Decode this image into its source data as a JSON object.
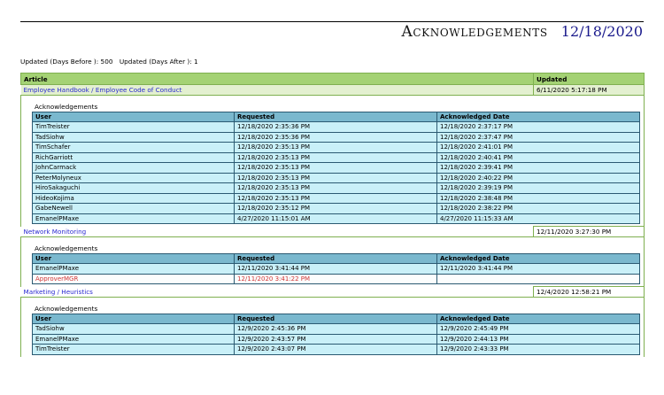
{
  "report": {
    "title": "Acknowledgements",
    "date": "12/18/2020"
  },
  "filters": {
    "before": "Updated (Days Before ): 500",
    "after": "Updated (Days After ): 1"
  },
  "columns": {
    "article": "Article",
    "updated": "Updated",
    "user": "User",
    "requested": "Requested",
    "acknowledged": "Acknowledged Date"
  },
  "ack_caption": "Acknowledgements",
  "articles": [
    {
      "name": "Employee Handbook / Employee Code of Conduct",
      "updated": "6/11/2020 5:17:18 PM",
      "rows": [
        {
          "user": "TimTreister",
          "requested": "12/18/2020 2:35:36 PM",
          "ack": "12/18/2020 2:37:17 PM"
        },
        {
          "user": "TadSiohw",
          "requested": "12/18/2020 2:35:36 PM",
          "ack": "12/18/2020 2:37:47 PM"
        },
        {
          "user": "TimSchafer",
          "requested": "12/18/2020 2:35:13 PM",
          "ack": "12/18/2020 2:41:01 PM"
        },
        {
          "user": "RichGarriott",
          "requested": "12/18/2020 2:35:13 PM",
          "ack": "12/18/2020 2:40:41 PM"
        },
        {
          "user": "JohnCarmack",
          "requested": "12/18/2020 2:35:13 PM",
          "ack": "12/18/2020 2:39:41 PM"
        },
        {
          "user": "PeterMolyneux",
          "requested": "12/18/2020 2:35:13 PM",
          "ack": "12/18/2020 2:40:22 PM"
        },
        {
          "user": "HiroSakaguchi",
          "requested": "12/18/2020 2:35:13 PM",
          "ack": "12/18/2020 2:39:19 PM"
        },
        {
          "user": "HideoKojima",
          "requested": "12/18/2020 2:35:13 PM",
          "ack": "12/18/2020 2:38:48 PM"
        },
        {
          "user": "GabeNewell",
          "requested": "12/18/2020 2:35:12 PM",
          "ack": "12/18/2020 2:38:22 PM"
        },
        {
          "user": "EmanelPMaxe",
          "requested": "4/27/2020 11:15:01 AM",
          "ack": "4/27/2020 11:15:33 AM"
        }
      ]
    },
    {
      "name": "Network Monitoring",
      "updated": "12/11/2020 3:27:30 PM",
      "rows": [
        {
          "user": "EmanelPMaxe",
          "requested": "12/11/2020 3:41:44 PM",
          "ack": "12/11/2020 3:41:44 PM"
        },
        {
          "user": "ApproverMGR",
          "requested": "12/11/2020 3:41:22 PM",
          "ack": "",
          "pending": true
        }
      ]
    },
    {
      "name": "Marketing / Heuristics",
      "updated": "12/4/2020 12:58:21 PM",
      "rows": [
        {
          "user": "TadSiohw",
          "requested": "12/9/2020 2:45:36 PM",
          "ack": "12/9/2020 2:45:49 PM"
        },
        {
          "user": "EmanelPMaxe",
          "requested": "12/9/2020 2:43:57 PM",
          "ack": "12/9/2020 2:44:13 PM"
        },
        {
          "user": "TimTreister",
          "requested": "12/9/2020 2:43:07 PM",
          "ack": "12/9/2020 2:43:33 PM"
        }
      ]
    }
  ]
}
